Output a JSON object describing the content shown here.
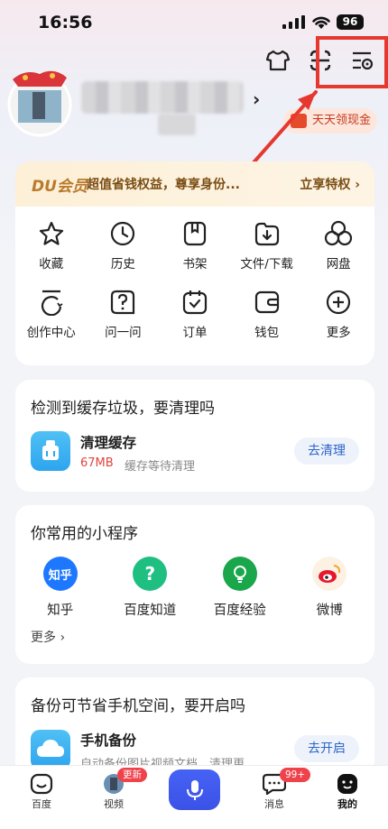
{
  "status_bar": {
    "time": "16:56",
    "battery": "96"
  },
  "profile": {
    "cash_badge": "天天领现金"
  },
  "vip": {
    "logo": "DU会员",
    "text": "超值省钱权益，尊享身份...",
    "cta": "立享特权 ›"
  },
  "shortcuts": [
    {
      "label": "收藏",
      "icon": "star-icon"
    },
    {
      "label": "历史",
      "icon": "clock-icon"
    },
    {
      "label": "书架",
      "icon": "bookmark-icon"
    },
    {
      "label": "文件/下载",
      "icon": "download-icon"
    },
    {
      "label": "网盘",
      "icon": "cloud-disk-icon"
    },
    {
      "label": "创作中心",
      "icon": "create-icon"
    },
    {
      "label": "问一问",
      "icon": "question-icon"
    },
    {
      "label": "订单",
      "icon": "order-icon"
    },
    {
      "label": "钱包",
      "icon": "wallet-icon"
    },
    {
      "label": "更多",
      "icon": "plus-icon"
    }
  ],
  "cache": {
    "title": "检测到缓存垃圾，要清理吗",
    "item_title": "清理缓存",
    "size": "67MB",
    "subtitle": "缓存等待清理",
    "button": "去清理"
  },
  "mini_programs": {
    "title": "你常用的小程序",
    "items": [
      {
        "label": "知乎",
        "icon_text": "知乎",
        "color": "#1e78ff"
      },
      {
        "label": "百度知道",
        "icon_text": "?",
        "color": "#1fbf82"
      },
      {
        "label": "百度经验",
        "icon_text": "",
        "color": "#1aa64a"
      },
      {
        "label": "微博",
        "icon_text": "",
        "color": "#f5a623"
      }
    ],
    "more": "更多 ›"
  },
  "backup": {
    "title": "备份可节省手机空间，要开启吗",
    "item_title": "手机备份",
    "subtitle": "自动备份图片视频文档，清理更...",
    "button": "去开启"
  },
  "tabbar": {
    "tabs": [
      "百度",
      "视频",
      "消息",
      "我的"
    ],
    "video_badge": "更新",
    "message_badge": "99+"
  },
  "colors": {
    "accent": "#3b52e7",
    "highlight": "#e6382f",
    "vip": "#7b4d14"
  }
}
